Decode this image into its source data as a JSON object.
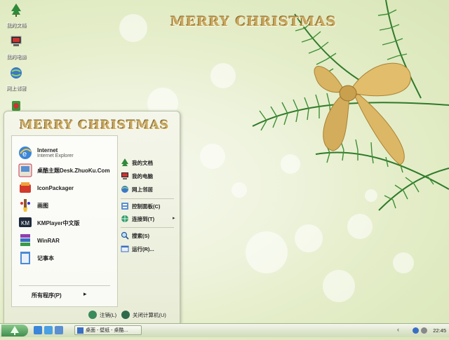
{
  "desktop": {
    "title": "MERRY CHRISTMAS",
    "icons": [
      {
        "label": "我的文档",
        "icon": "tree-folder-icon"
      },
      {
        "label": "我的电脑",
        "icon": "computer-icon"
      },
      {
        "label": "网上邻居",
        "icon": "network-globe-icon"
      },
      {
        "label": "",
        "icon": "recycle-bin-icon"
      }
    ]
  },
  "start_menu": {
    "title": "MERRY CHRISTMAS",
    "programs": [
      {
        "title": "Internet",
        "subtitle": "Internet Explorer",
        "icon": "internet-explorer-icon"
      },
      {
        "title": "桌酷主题Desk.ZhuoKu.Com",
        "icon": "zhuoku-theme-icon"
      },
      {
        "title": "IconPackager",
        "icon": "iconpackager-icon"
      },
      {
        "title": "画图",
        "icon": "paint-icon"
      },
      {
        "title": "KMPlayer中文版",
        "icon": "kmplayer-icon"
      },
      {
        "title": "WinRAR",
        "icon": "winrar-icon"
      },
      {
        "title": "记事本",
        "icon": "notepad-icon"
      }
    ],
    "all_programs": "所有程序(P)",
    "places": [
      {
        "label": "我的文档",
        "icon": "tree-folder-icon"
      },
      {
        "label": "我的电脑",
        "icon": "computer-icon"
      },
      {
        "label": "网上邻居",
        "icon": "network-globe-icon"
      },
      {
        "label": "控制面板(C)",
        "icon": "control-panel-icon"
      },
      {
        "label": "连接到(T)",
        "icon": "connect-globe-icon"
      },
      {
        "label": "搜索(S)",
        "icon": "search-icon"
      },
      {
        "label": "运行(R)...",
        "icon": "run-icon"
      }
    ],
    "logoff": "注销(L)",
    "shutdown": "关闭计算机(U)"
  },
  "taskbar": {
    "task_label": "桌面 - 壁纸 - 桌酷...",
    "clock": "22:45"
  },
  "colors": {
    "title_gold": "#c7a75f",
    "taskbar_green": "#3f8e4f"
  }
}
